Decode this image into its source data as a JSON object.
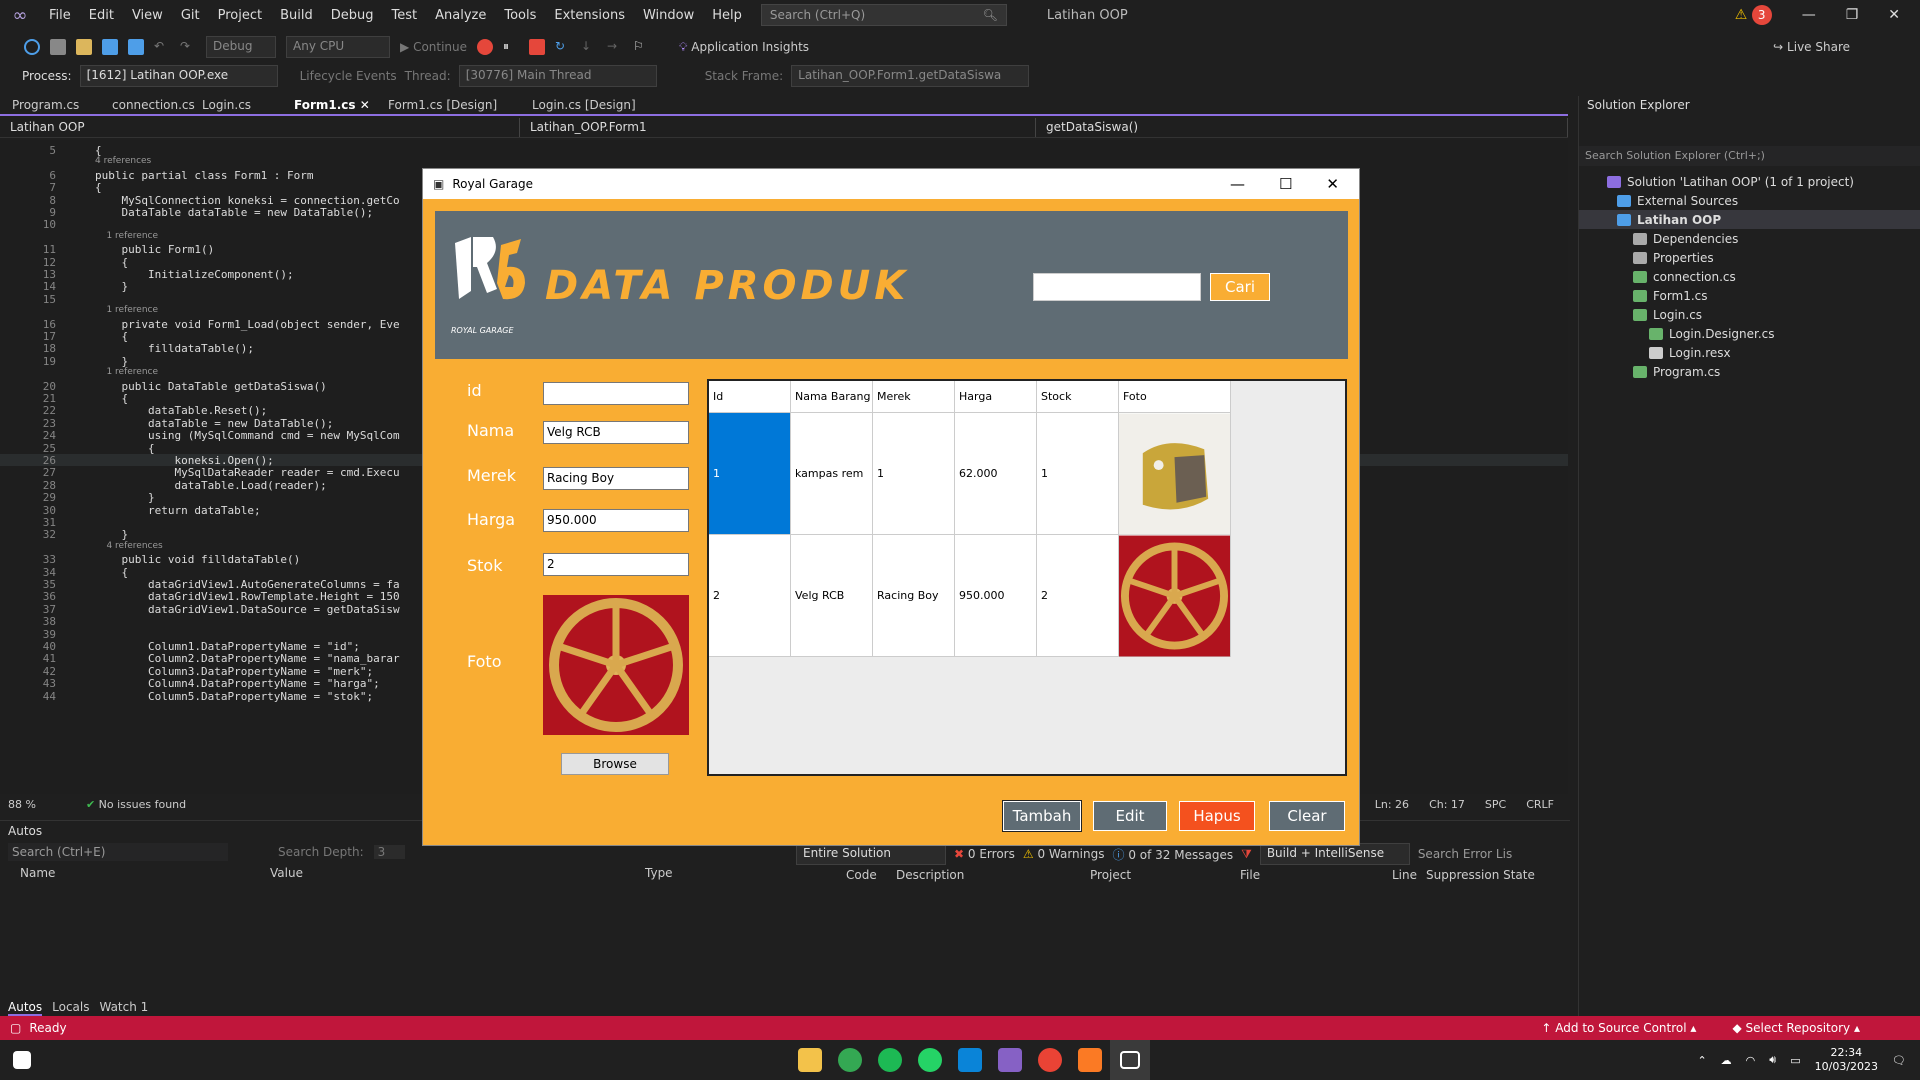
{
  "menu": [
    "File",
    "Edit",
    "View",
    "Git",
    "Project",
    "Build",
    "Debug",
    "Test",
    "Analyze",
    "Tools",
    "Extensions",
    "Window",
    "Help"
  ],
  "search_placeholder": "Search (Ctrl+Q)",
  "window_title": "Latihan OOP",
  "warning_count": "3",
  "live_share": "Live Share",
  "toolbar": {
    "config": "Debug",
    "platform": "Any CPU",
    "continue": "Continue",
    "insights": "Application Insights"
  },
  "debugbar": {
    "process_label": "Process:",
    "process": "[1612] Latihan OOP.exe",
    "lifecycle": "Lifecycle Events",
    "thread_label": "Thread:",
    "thread": "[30776] Main Thread",
    "stack_label": "Stack Frame:",
    "stack": "Latihan_OOP.Form1.getDataSiswa"
  },
  "tabs": [
    "Program.cs",
    "connection.cs",
    "Login.cs",
    "Form1.cs",
    "Form1.cs [Design]",
    "Login.cs [Design]"
  ],
  "nav": {
    "project": "Latihan OOP",
    "class": "Latihan_OOP.Form1",
    "member": "getDataSiswa()"
  },
  "code_lines": [
    {
      "n": "5",
      "t": "{"
    },
    {
      "n": "",
      "t": "4 references"
    },
    {
      "n": "6",
      "t": "public partial class Form1 : Form"
    },
    {
      "n": "7",
      "t": "{"
    },
    {
      "n": "8",
      "t": "    MySqlConnection koneksi = connection.getCo"
    },
    {
      "n": "9",
      "t": "    DataTable dataTable = new DataTable();"
    },
    {
      "n": "10",
      "t": ""
    },
    {
      "n": "",
      "t": "    1 reference"
    },
    {
      "n": "11",
      "t": "    public Form1()"
    },
    {
      "n": "12",
      "t": "    {"
    },
    {
      "n": "13",
      "t": "        InitializeComponent();"
    },
    {
      "n": "14",
      "t": "    }"
    },
    {
      "n": "15",
      "t": ""
    },
    {
      "n": "",
      "t": "    1 reference"
    },
    {
      "n": "16",
      "t": "    private void Form1_Load(object sender, Eve"
    },
    {
      "n": "17",
      "t": "    {"
    },
    {
      "n": "18",
      "t": "        filldataTable();"
    },
    {
      "n": "19",
      "t": "    }"
    },
    {
      "n": "",
      "t": "    1 reference"
    },
    {
      "n": "20",
      "t": "    public DataTable getDataSiswa()"
    },
    {
      "n": "21",
      "t": "    {"
    },
    {
      "n": "22",
      "t": "        dataTable.Reset();"
    },
    {
      "n": "23",
      "t": "        dataTable = new DataTable();"
    },
    {
      "n": "24",
      "t": "        using (MySqlCommand cmd = new MySqlCom"
    },
    {
      "n": "25",
      "t": "        {"
    },
    {
      "n": "26",
      "t": "            koneksi.Open();"
    },
    {
      "n": "27",
      "t": "            MySqlDataReader reader = cmd.Execu"
    },
    {
      "n": "28",
      "t": "            dataTable.Load(reader);"
    },
    {
      "n": "29",
      "t": "        }"
    },
    {
      "n": "30",
      "t": "        return dataTable;"
    },
    {
      "n": "31",
      "t": ""
    },
    {
      "n": "32",
      "t": "    }"
    },
    {
      "n": "",
      "t": "    4 references"
    },
    {
      "n": "33",
      "t": "    public void filldataTable()"
    },
    {
      "n": "34",
      "t": "    {"
    },
    {
      "n": "35",
      "t": "        dataGridView1.AutoGenerateColumns = fa"
    },
    {
      "n": "36",
      "t": "        dataGridView1.RowTemplate.Height = 150"
    },
    {
      "n": "37",
      "t": "        dataGridView1.DataSource = getDataSisw"
    },
    {
      "n": "38",
      "t": ""
    },
    {
      "n": "39",
      "t": ""
    },
    {
      "n": "40",
      "t": "        Column1.DataPropertyName = \"id\";"
    },
    {
      "n": "41",
      "t": "        Column2.DataPropertyName = \"nama_barar"
    },
    {
      "n": "42",
      "t": "        Column3.DataPropertyName = \"merk\";"
    },
    {
      "n": "43",
      "t": "        Column4.DataPropertyName = \"harga\";"
    },
    {
      "n": "44",
      "t": "        Column5.DataPropertyName = \"stok\";"
    }
  ],
  "editor_status": {
    "zoom": "88 %",
    "issues": "No issues found",
    "ln": "Ln: 26",
    "ch": "Ch: 17",
    "spc": "SPC",
    "crlf": "CRLF"
  },
  "solution_explorer": {
    "title": "Solution Explorer",
    "search": "Search Solution Explorer (Ctrl+;)",
    "items": [
      {
        "label": "Solution 'Latihan OOP' (1 of 1 project)",
        "bold": false
      },
      {
        "label": "External Sources",
        "bold": false
      },
      {
        "label": "Latihan OOP",
        "bold": true
      },
      {
        "label": "Dependencies",
        "bold": false
      },
      {
        "label": "Properties",
        "bold": false
      },
      {
        "label": "connection.cs",
        "bold": false
      },
      {
        "label": "Form1.cs",
        "bold": false
      },
      {
        "label": "Login.cs",
        "bold": false
      },
      {
        "label": "Login.Designer.cs",
        "bold": false
      },
      {
        "label": "Login.resx",
        "bold": false
      },
      {
        "label": "Program.cs",
        "bold": false
      }
    ]
  },
  "autos": {
    "title": "Autos",
    "search": "Search (Ctrl+E)",
    "depth_label": "Search Depth:",
    "depth": "3",
    "cols": [
      "Name",
      "Value",
      "Type"
    ],
    "tabs": [
      "Autos",
      "Locals",
      "Watch 1"
    ]
  },
  "errorlist": {
    "scope": "Entire Solution",
    "errors": "0 Errors",
    "warnings": "0 Warnings",
    "messages": "0 of 32 Messages",
    "build": "Build + IntelliSense",
    "search": "Search Error Lis",
    "cols": [
      "Code",
      "Description",
      "Project",
      "File",
      "Line",
      "Suppression State"
    ]
  },
  "statusbar": {
    "ready": "Ready",
    "source_control": "Add to Source Control",
    "repo": "Select Repository"
  },
  "clock": {
    "time": "22:34",
    "date": "10/03/2023"
  },
  "form": {
    "title": "Royal Garage",
    "banner_title": "DATA PRODUK",
    "logo_sub": "ROYAL GARAGE",
    "search_button": "Cari",
    "labels": {
      "id": "id",
      "nama": "Nama",
      "merek": "Merek",
      "harga": "Harga",
      "stok": "Stok",
      "foto": "Foto"
    },
    "values": {
      "id": "",
      "nama": "Velg RCB",
      "merek": "Racing Boy",
      "harga": "950.000",
      "stok": "2"
    },
    "browse": "Browse",
    "grid": {
      "headers": [
        "Id",
        "Nama Barang",
        "Merek",
        "Harga",
        "Stock",
        "Foto"
      ],
      "rows": [
        [
          "1",
          "kampas rem",
          "1",
          "62.000",
          "1",
          ""
        ],
        [
          "2",
          "Velg RCB",
          "Racing Boy",
          "950.000",
          "2",
          ""
        ]
      ]
    },
    "buttons": {
      "tambah": "Tambah",
      "edit": "Edit",
      "hapus": "Hapus",
      "clear": "Clear"
    }
  }
}
